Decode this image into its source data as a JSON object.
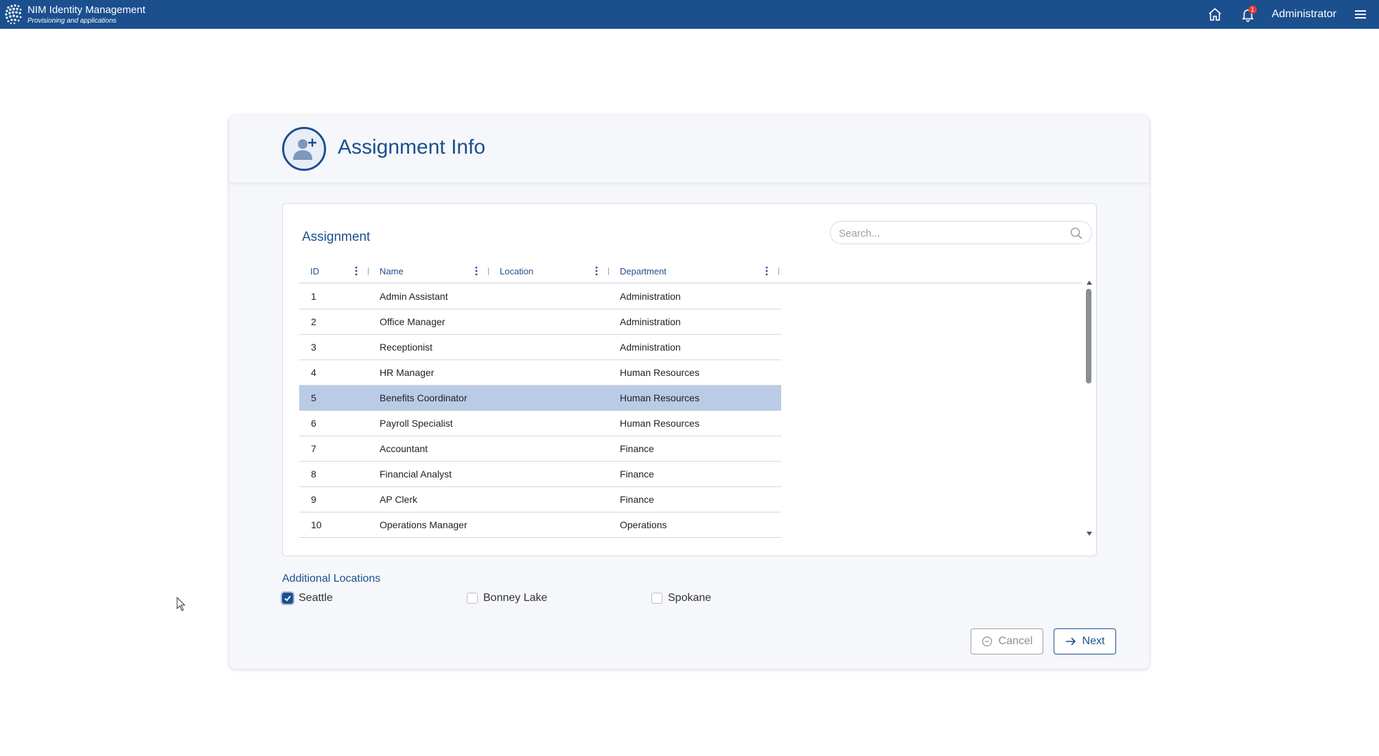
{
  "app": {
    "title": "NIM Identity Management",
    "subtitle": "Provisioning and applications",
    "notifications_count": "1",
    "user": "Administrator",
    "icons": {
      "logo": "globe-logo-icon",
      "home": "home-icon",
      "notifications": "bell-icon",
      "menu": "hamburger-menu-icon"
    }
  },
  "page": {
    "title": "Assignment Info",
    "icon": "user-add-icon"
  },
  "assignment": {
    "title": "Assignment",
    "search_placeholder": "Search...",
    "columns": [
      "ID",
      "Name",
      "Location",
      "Department"
    ],
    "rows": [
      {
        "id": "1",
        "name": "Admin Assistant",
        "location": "",
        "department": "Administration"
      },
      {
        "id": "2",
        "name": "Office Manager",
        "location": "",
        "department": "Administration"
      },
      {
        "id": "3",
        "name": "Receptionist",
        "location": "",
        "department": "Administration"
      },
      {
        "id": "4",
        "name": "HR Manager",
        "location": "",
        "department": "Human Resources"
      },
      {
        "id": "5",
        "name": "Benefits Coordinator",
        "location": "",
        "department": "Human Resources",
        "selected": true
      },
      {
        "id": "6",
        "name": "Payroll Specialist",
        "location": "",
        "department": "Human Resources"
      },
      {
        "id": "7",
        "name": "Accountant",
        "location": "",
        "department": "Finance"
      },
      {
        "id": "8",
        "name": "Financial Analyst",
        "location": "",
        "department": "Finance"
      },
      {
        "id": "9",
        "name": "AP Clerk",
        "location": "",
        "department": "Finance"
      },
      {
        "id": "10",
        "name": "Operations Manager",
        "location": "",
        "department": "Operations"
      }
    ]
  },
  "additional_locations": {
    "title": "Additional Locations",
    "options": [
      {
        "label": "Seattle",
        "checked": true
      },
      {
        "label": "Bonney Lake",
        "checked": false
      },
      {
        "label": "Spokane",
        "checked": false
      }
    ]
  },
  "actions": {
    "cancel": "Cancel",
    "next": "Next"
  },
  "colors": {
    "primary": "#1b4f8e",
    "selected_row": "#b9cbe5",
    "badge": "#e53935"
  }
}
